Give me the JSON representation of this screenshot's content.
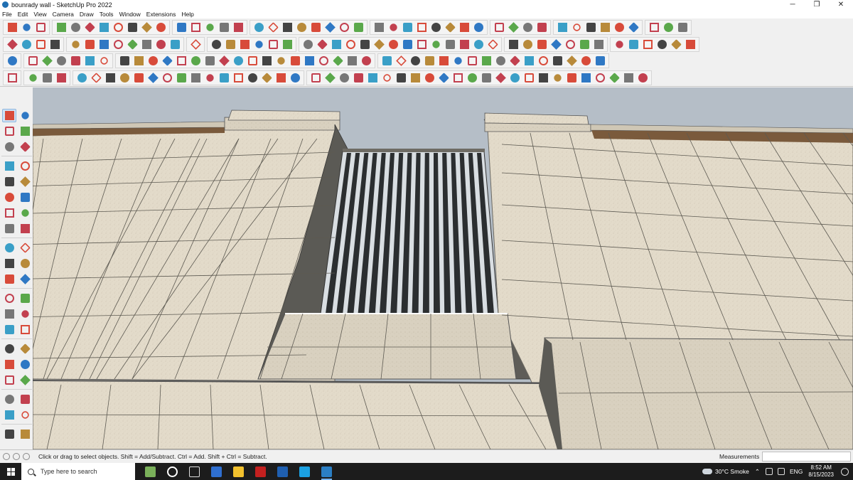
{
  "window": {
    "title": "bounrady wall - SketchUp Pro 2022",
    "controls": [
      "─",
      "❐",
      "✕"
    ]
  },
  "menu": [
    "File",
    "Edit",
    "View",
    "Camera",
    "Draw",
    "Tools",
    "Window",
    "Extensions",
    "Help"
  ],
  "colors": {
    "sky": "#b5bec7",
    "stone": "#e4dccb",
    "stone_shadow": "#5b5a55",
    "grille_bar": "#2b2e30",
    "grille_gap": "#d9dee2",
    "selection": "#cde3f7",
    "taskbar": "#1c1c1c"
  },
  "status": {
    "hint": "Click or drag to select objects. Shift = Add/Subtract. Ctrl = Add. Shift + Ctrl = Subtract.",
    "measurements_label": "Measurements",
    "measurements_value": ""
  },
  "taskbar": {
    "search_placeholder": "Type here to search",
    "weather": "30°C  Smoke",
    "language": "ENG",
    "time": "8:52 AM",
    "date": "8/15/2023",
    "apps": [
      "minecraft-icon",
      "headset-icon",
      "task-view-icon",
      "calculator-icon",
      "file-explorer-icon",
      "autocad-icon",
      "photoshop-icon",
      "edge-icon",
      "sketchup-icon"
    ]
  }
}
